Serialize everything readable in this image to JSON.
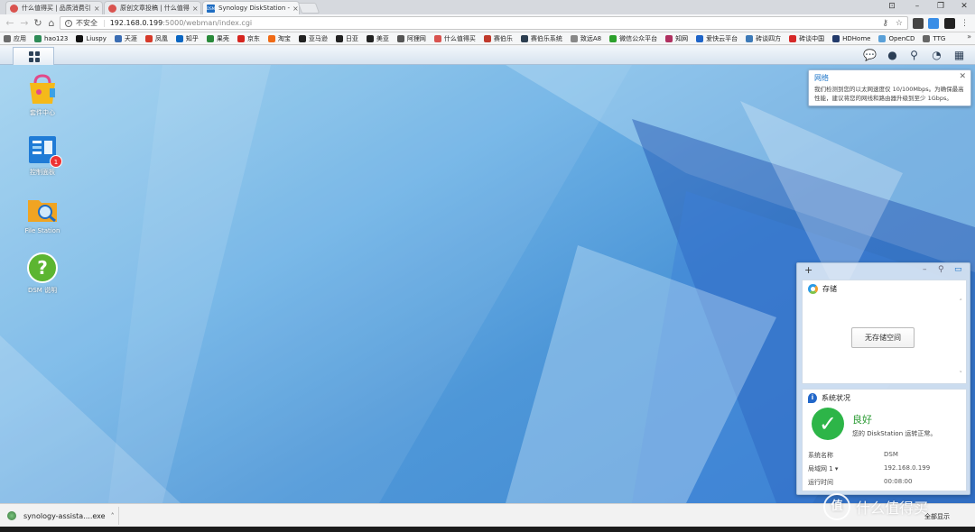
{
  "browser": {
    "tabs": [
      {
        "title": "什么值得买 | 品质消费引",
        "icon": "zdm-icon",
        "active": false
      },
      {
        "title": "原创文章投稿 | 什么值得",
        "icon": "zdm-icon",
        "active": false
      },
      {
        "title": "Synology DiskStation -",
        "icon": "dsm-icon",
        "active": true
      }
    ],
    "favicon_text": "DSM",
    "address": {
      "security_label": "不安全",
      "host": "192.168.0.199",
      "path": ":5000/webman/index.cgi"
    },
    "bookmarks": [
      {
        "label": "应用",
        "color": "#6b6b6b"
      },
      {
        "label": "hao123",
        "color": "#2e8b57"
      },
      {
        "label": "Liuspy",
        "color": "#111111"
      },
      {
        "label": "天涯",
        "color": "#3b6db3"
      },
      {
        "label": "凤凰",
        "color": "#d63a2a"
      },
      {
        "label": "知乎",
        "color": "#0a66c2"
      },
      {
        "label": "果壳",
        "color": "#2a8a3a"
      },
      {
        "label": "京东",
        "color": "#d6251f"
      },
      {
        "label": "淘宝",
        "color": "#f06a16"
      },
      {
        "label": "亚马逊",
        "color": "#222222"
      },
      {
        "label": "日亚",
        "color": "#222222"
      },
      {
        "label": "美亚",
        "color": "#222222"
      },
      {
        "label": "阿狸网",
        "color": "#555555"
      },
      {
        "label": "什么值得买",
        "color": "#d9534f"
      },
      {
        "label": "赛伯乐",
        "color": "#c0392b"
      },
      {
        "label": "赛伯乐系统",
        "color": "#2c3e50"
      },
      {
        "label": "致远A8",
        "color": "#888888"
      },
      {
        "label": "微信公众平台",
        "color": "#2ca02c"
      },
      {
        "label": "知网",
        "color": "#b03060"
      },
      {
        "label": "爱快云平台",
        "color": "#1e64c8"
      },
      {
        "label": "砖谈四方",
        "color": "#3d7ab8"
      },
      {
        "label": "砖谈中国",
        "color": "#d62828"
      },
      {
        "label": "HDHome",
        "color": "#223a6b"
      },
      {
        "label": "OpenCD",
        "color": "#5aa0d8"
      },
      {
        "label": "TTG",
        "color": "#666666"
      }
    ],
    "bookmarks_more": "»"
  },
  "desktop": {
    "icons": [
      {
        "label": "套件中心",
        "name": "package-center"
      },
      {
        "label": "控制面板",
        "name": "control-panel",
        "badge": "1"
      },
      {
        "label": "File Station",
        "name": "file-station"
      },
      {
        "label": "DSM 说明",
        "name": "dsm-help"
      }
    ]
  },
  "notification": {
    "title": "网络",
    "body": "我们检测到您的以太网速度仅 10/100Mbps。为确保最高性能，建议将您的网线和路由器升级到至少 1Gbps。"
  },
  "widgets": {
    "storage": {
      "title": "存储",
      "empty_label": "无存储空间"
    },
    "system": {
      "title": "系统状况",
      "status": "良好",
      "message": "您的 DiskStation 运转正常。",
      "rows": [
        {
          "key": "系统名称",
          "value": "DSM"
        },
        {
          "key": "局域网 1 ▾",
          "value": "192.168.0.199"
        },
        {
          "key": "运行时间",
          "value": "00:08:00"
        }
      ]
    }
  },
  "downloads": {
    "file": "synology-assista....exe",
    "show_all": "全部显示"
  },
  "watermark": "什么值得买",
  "colors": {
    "accent": "#1a73c8",
    "ok": "#2db548",
    "badge": "#e33333"
  }
}
